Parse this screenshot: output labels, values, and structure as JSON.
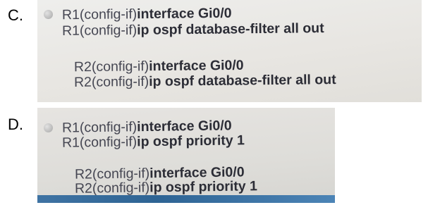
{
  "options": [
    {
      "letter": "C.",
      "lines": [
        {
          "prompt": "R1(config-if)",
          "command": "interface Gi0/0"
        },
        {
          "prompt": "R1(config-if)",
          "command": "ip ospf database-filter all out"
        },
        {
          "prompt": "R2(config-if)",
          "command": "interface Gi0/0"
        },
        {
          "prompt": "R2(config-if)",
          "command": "ip ospf database-filter all out"
        }
      ]
    },
    {
      "letter": "D.",
      "lines": [
        {
          "prompt": "R1(config-if)",
          "command": "interface Gi0/0"
        },
        {
          "prompt": "R1(config-if)",
          "command": "ip ospf priority 1"
        },
        {
          "prompt": "R2(config-if)",
          "command": "interface Gi0/0"
        },
        {
          "prompt": "R2(config-if)",
          "command": "ip ospf priority 1"
        }
      ]
    }
  ],
  "colors": {
    "text": "#3a3b45",
    "strip": "#2e6494"
  },
  "icons": [
    "radio-button-icon"
  ]
}
